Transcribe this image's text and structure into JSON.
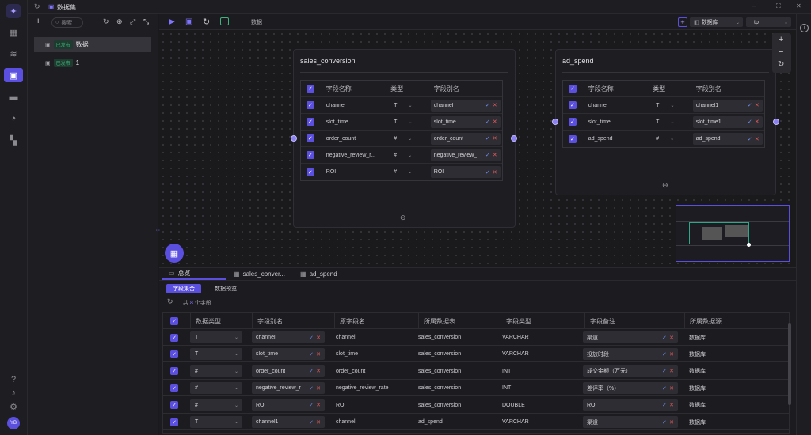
{
  "header": {
    "title": "数据集"
  },
  "rail": {
    "avatar": "YB"
  },
  "left_panel": {
    "search_placeholder": "搜索",
    "items": [
      {
        "badge": "已发布",
        "name": "数据"
      },
      {
        "badge": "已发布",
        "name": "1"
      }
    ]
  },
  "toolbar": {
    "label": "数据",
    "datasource": "数据库",
    "db": "tp"
  },
  "nodes": [
    {
      "title": "sales_conversion",
      "headers": [
        "字段名称",
        "类型",
        "字段别名"
      ],
      "rows": [
        {
          "name": "channel",
          "type": "T",
          "alias": "channel"
        },
        {
          "name": "slot_time",
          "type": "T",
          "alias": "slot_time"
        },
        {
          "name": "order_count",
          "type": "#",
          "alias": "order_count"
        },
        {
          "name": "negative_review_r...",
          "type": "#",
          "alias": "negative_review_"
        },
        {
          "name": "ROI",
          "type": "#",
          "alias": "ROI"
        }
      ]
    },
    {
      "title": "ad_spend",
      "headers": [
        "字段名称",
        "类型",
        "字段别名"
      ],
      "rows": [
        {
          "name": "channel",
          "type": "T",
          "alias": "channel1"
        },
        {
          "name": "slot_time",
          "type": "T",
          "alias": "slot_time1"
        },
        {
          "name": "ad_spend",
          "type": "#",
          "alias": "ad_spend"
        }
      ]
    }
  ],
  "bottom": {
    "tabs": [
      "总览",
      "sales_conver...",
      "ad_spend"
    ],
    "subtabs": [
      "字段集合",
      "数据预览"
    ],
    "count_prefix": "共",
    "count": "8",
    "count_suffix": "个字段",
    "columns": [
      "数据类型",
      "字段别名",
      "原字段名",
      "所属数据表",
      "字段类型",
      "字段备注",
      "所属数据源"
    ],
    "rows": [
      {
        "type": "T",
        "alias": "channel",
        "orig": "channel",
        "table": "sales_conversion",
        "ftype": "VARCHAR",
        "remark": "渠道",
        "source": "数据库"
      },
      {
        "type": "T",
        "alias": "slot_time",
        "orig": "slot_time",
        "table": "sales_conversion",
        "ftype": "VARCHAR",
        "remark": "投放时段",
        "source": "数据库"
      },
      {
        "type": "#",
        "alias": "order_count",
        "orig": "order_count",
        "table": "sales_conversion",
        "ftype": "INT",
        "remark": "成交金额（万元）",
        "source": "数据库"
      },
      {
        "type": "#",
        "alias": "negative_review_r",
        "orig": "negative_review_rate",
        "table": "sales_conversion",
        "ftype": "INT",
        "remark": "差评率（%）",
        "source": "数据库"
      },
      {
        "type": "#",
        "alias": "ROI",
        "orig": "ROI",
        "table": "sales_conversion",
        "ftype": "DOUBLE",
        "remark": "ROI",
        "source": "数据库"
      },
      {
        "type": "T",
        "alias": "channel1",
        "orig": "channel",
        "table": "ad_spend",
        "ftype": "VARCHAR",
        "remark": "渠道",
        "source": "数据库"
      }
    ]
  },
  "colors": {
    "accent": "#5b4fe0",
    "bg": "#1a1a1d",
    "panel": "#1e1e22"
  }
}
